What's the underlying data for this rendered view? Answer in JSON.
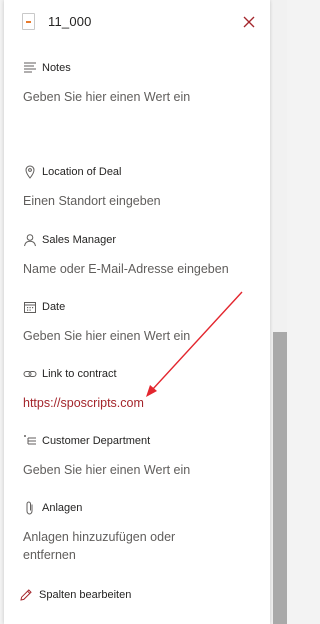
{
  "header": {
    "title": "11_000"
  },
  "fields": {
    "notes": {
      "label": "Notes",
      "value": "Geben Sie hier einen Wert ein"
    },
    "location": {
      "label": "Location of Deal",
      "value": "Einen Standort eingeben"
    },
    "sales_manager": {
      "label": "Sales Manager",
      "value": "Name oder E-Mail-Adresse eingeben"
    },
    "date": {
      "label": "Date",
      "value": "Geben Sie hier einen Wert ein"
    },
    "link": {
      "label": "Link to contract",
      "value": "https://sposcripts.com"
    },
    "customer_department": {
      "label": "Customer Department",
      "value": "Geben Sie hier einen Wert ein"
    },
    "attachments": {
      "label": "Anlagen",
      "value": "Anlagen hinzuzufügen oder entfernen"
    }
  },
  "footer": {
    "edit_columns_label": "Spalten bearbeiten"
  },
  "colors": {
    "accent_red": "#a4262c",
    "annotation_arrow": "#e3262e",
    "icon_gray": "#605e5c"
  },
  "icons": {
    "file": "file-icon",
    "close": "close-icon",
    "notes": "text-lines-icon",
    "location": "map-pin-icon",
    "person": "person-icon",
    "calendar": "calendar-icon",
    "link": "link-icon",
    "choice": "choice-list-icon",
    "attachment": "paperclip-icon",
    "edit": "pencil-icon"
  }
}
